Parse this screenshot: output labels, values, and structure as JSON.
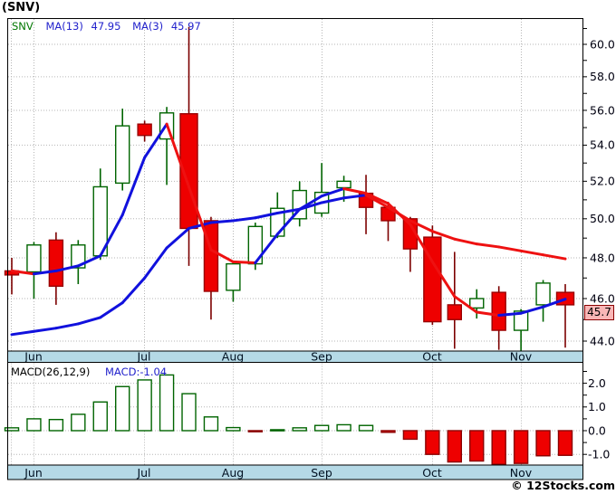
{
  "header": {
    "title": "(SNV)"
  },
  "price_panel": {
    "legend": {
      "symbol": "SNV",
      "ma13_label": "MA(13)",
      "ma13_value": "47.95",
      "ma3_label": "MA(3)",
      "ma3_value": "45.97"
    },
    "last_price_badge": "45.7"
  },
  "macd_panel": {
    "legend_label": "MACD(26,12,9)",
    "legend_value": "MACD:-1.04"
  },
  "footer": {
    "copyright": "© 12Stocks.com"
  },
  "chart_data": {
    "type": "candlestick",
    "symbol": "SNV",
    "title": "(SNV) weekly candlestick chart with MA(13), MA(3) and MACD(26,12,9)",
    "months": [
      "Jun",
      "Jul",
      "Aug",
      "Sep",
      "Oct",
      "Nov"
    ],
    "month_x": [
      37,
      159,
      257,
      355,
      477,
      575
    ],
    "extra_vgrid_x": [
      12
    ],
    "price_axis": {
      "scale": "log",
      "labels": [
        "60.0",
        "58.0",
        "56.0",
        "54.0",
        "52.0",
        "50.0",
        "48.0",
        "46.0",
        "44.0"
      ],
      "values": [
        60,
        58,
        56,
        54,
        52,
        50,
        48,
        46,
        44
      ],
      "minor_step": 1,
      "last_price": 45.7
    },
    "macd_axis": {
      "labels": [
        "2.0",
        "1.0",
        "0.0",
        "-1.0"
      ],
      "values": [
        2,
        1,
        0,
        -1
      ],
      "minor_step": 0.5,
      "last_macd": -1.04
    },
    "candles": [
      [
        47.35,
        48.0,
        46.2,
        47.15
      ],
      [
        47.3,
        48.8,
        46.0,
        48.65
      ],
      [
        48.9,
        49.3,
        45.7,
        46.6
      ],
      [
        47.5,
        48.9,
        46.7,
        48.65
      ],
      [
        48.1,
        52.7,
        47.9,
        51.7
      ],
      [
        51.9,
        56.1,
        51.5,
        55.1
      ],
      [
        55.2,
        55.4,
        54.2,
        54.55
      ],
      [
        54.35,
        56.2,
        51.8,
        55.85
      ],
      [
        55.8,
        61.1,
        47.6,
        49.5
      ],
      [
        49.9,
        50.1,
        45.0,
        46.35
      ],
      [
        46.4,
        47.8,
        45.85,
        47.7
      ],
      [
        47.7,
        49.8,
        47.4,
        49.6
      ],
      [
        49.1,
        51.4,
        49.0,
        50.55
      ],
      [
        50.0,
        52.0,
        49.6,
        51.5
      ],
      [
        50.3,
        53.0,
        50.1,
        51.4
      ],
      [
        51.65,
        52.3,
        50.9,
        52.0
      ],
      [
        51.35,
        52.35,
        49.2,
        50.6
      ],
      [
        50.6,
        50.9,
        48.85,
        49.9
      ],
      [
        50.0,
        50.1,
        47.3,
        48.45
      ],
      [
        49.05,
        49.65,
        44.75,
        44.9
      ],
      [
        45.7,
        48.3,
        43.65,
        45.0
      ],
      [
        45.55,
        46.45,
        45.05,
        46.0
      ],
      [
        46.3,
        46.6,
        43.6,
        44.5
      ],
      [
        44.5,
        45.5,
        43.55,
        45.4
      ],
      [
        45.7,
        46.9,
        44.9,
        46.75
      ],
      [
        46.3,
        46.7,
        43.7,
        45.7
      ]
    ],
    "ma3": [
      47.35,
      47.2,
      47.35,
      47.6,
      48.1,
      50.2,
      53.3,
      55.2,
      51.7,
      48.4,
      47.8,
      47.75,
      49.2,
      50.5,
      51.2,
      51.6,
      51.35,
      50.8,
      49.7,
      47.8,
      46.1,
      45.35,
      45.2,
      45.3,
      45.6,
      45.97
    ],
    "ma13": [
      44.3,
      44.45,
      44.6,
      44.8,
      45.1,
      45.8,
      47.0,
      48.5,
      49.5,
      49.8,
      49.9,
      50.05,
      50.3,
      50.5,
      50.85,
      51.1,
      51.25,
      50.6,
      49.9,
      49.35,
      48.95,
      48.7,
      48.55,
      48.35,
      48.15,
      47.95
    ],
    "macd_histogram": [
      0.12,
      0.5,
      0.47,
      0.69,
      1.21,
      1.86,
      2.14,
      2.35,
      1.56,
      0.58,
      0.13,
      -0.04,
      0.04,
      0.12,
      0.22,
      0.25,
      0.22,
      -0.07,
      -0.36,
      -1.0,
      -1.32,
      -1.28,
      -1.42,
      -1.38,
      -1.06,
      -1.04
    ],
    "colors": {
      "trend_up": "#1111dd",
      "trend_down": "#ee1111",
      "candle_up_stroke": "#006400",
      "candle_up_fill": "#ffffff",
      "candle_down_stroke": "#990000",
      "candle_down_fill": "#ee0000",
      "wick_up": "#006400",
      "wick_down": "#7c0000",
      "hist_pos_stroke": "#006400",
      "hist_pos_fill": "#ffffff",
      "hist_neg_stroke": "#8b0000",
      "hist_neg_fill": "#ee0000",
      "grid": "#b6b6b6",
      "strip_bg": "#b5d9e6",
      "axis_text": "#000010",
      "month_text": "#001122",
      "badge_bg": "#f9b6b6",
      "badge_border": "#8b0000",
      "legend_symbol": "#007700",
      "legend_ma": "#2222cc"
    }
  }
}
